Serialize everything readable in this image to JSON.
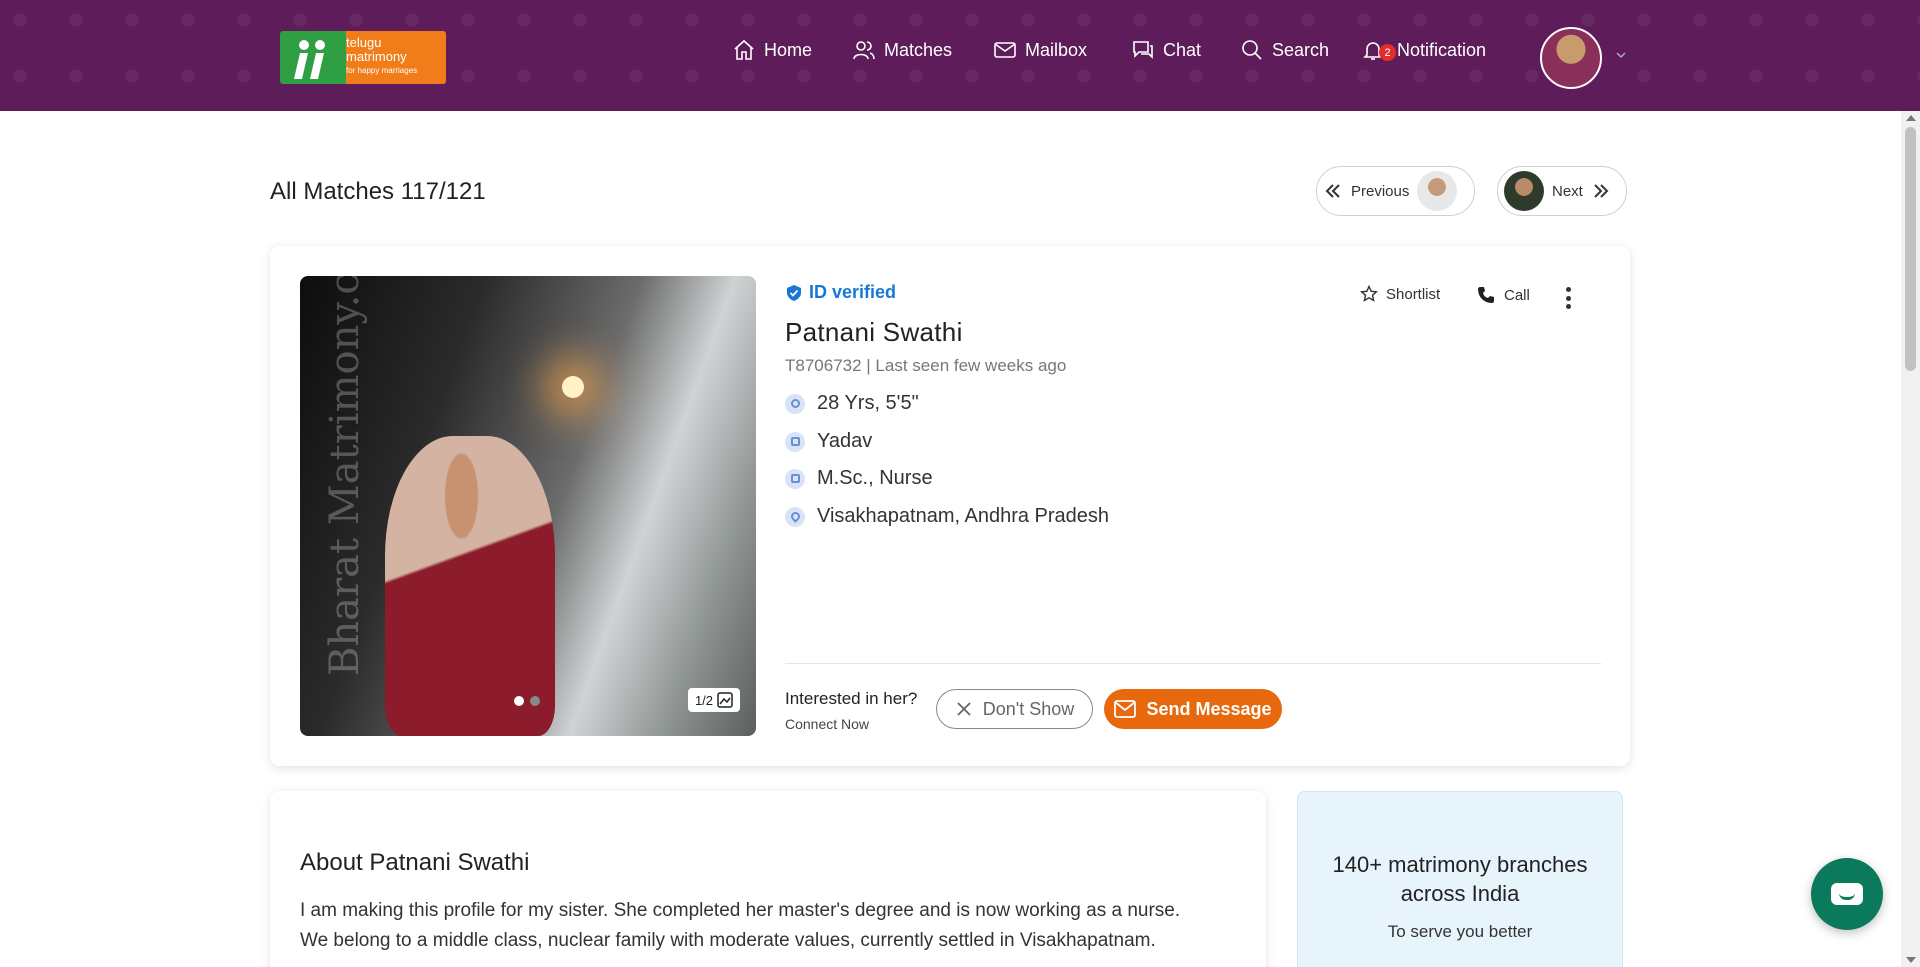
{
  "header": {
    "logo": {
      "line1": "telugu",
      "line2": "matrimony",
      "tagline": "for happy marriages"
    },
    "nav": [
      {
        "label": "Home",
        "icon": "home-icon"
      },
      {
        "label": "Matches",
        "icon": "users-icon"
      },
      {
        "label": "Mailbox",
        "icon": "mail-icon"
      },
      {
        "label": "Chat",
        "icon": "chat-icon"
      },
      {
        "label": "Search",
        "icon": "search-icon"
      },
      {
        "label": "Notification",
        "icon": "bell-icon",
        "badge": "2"
      }
    ],
    "colors": {
      "background": "#5e1d5a"
    }
  },
  "page": {
    "title": "All Matches 117/121",
    "previous_label": "Previous",
    "next_label": "Next"
  },
  "profile": {
    "verified_label": "ID verified",
    "name": "Patnani Swathi",
    "meta": "T8706732 | Last seen few weeks ago",
    "age_height": "28 Yrs, 5'5\"",
    "caste": "Yadav",
    "education_job": "M.Sc., Nurse",
    "location": "Visakhapatnam, Andhra Pradesh",
    "photo_counter": "1/2",
    "watermark": "Bharat Matrimony.com",
    "shortlist_label": "Shortlist",
    "call_label": "Call",
    "interest_question": "Interested in her?",
    "interest_sub": "Connect Now",
    "dont_show_label": "Don't Show",
    "send_message_label": "Send Message",
    "colors": {
      "verified": "#1877d6",
      "send_button": "#e8690d"
    }
  },
  "about": {
    "title": "About Patnani Swathi",
    "text": "I am making this profile for my sister. She completed her master's degree and is now working as a nurse. We belong to a middle class, nuclear family with moderate values, currently settled in Visakhapatnam."
  },
  "branches": {
    "title": "140+ matrimony branches across India",
    "subtitle": "To serve you better"
  }
}
